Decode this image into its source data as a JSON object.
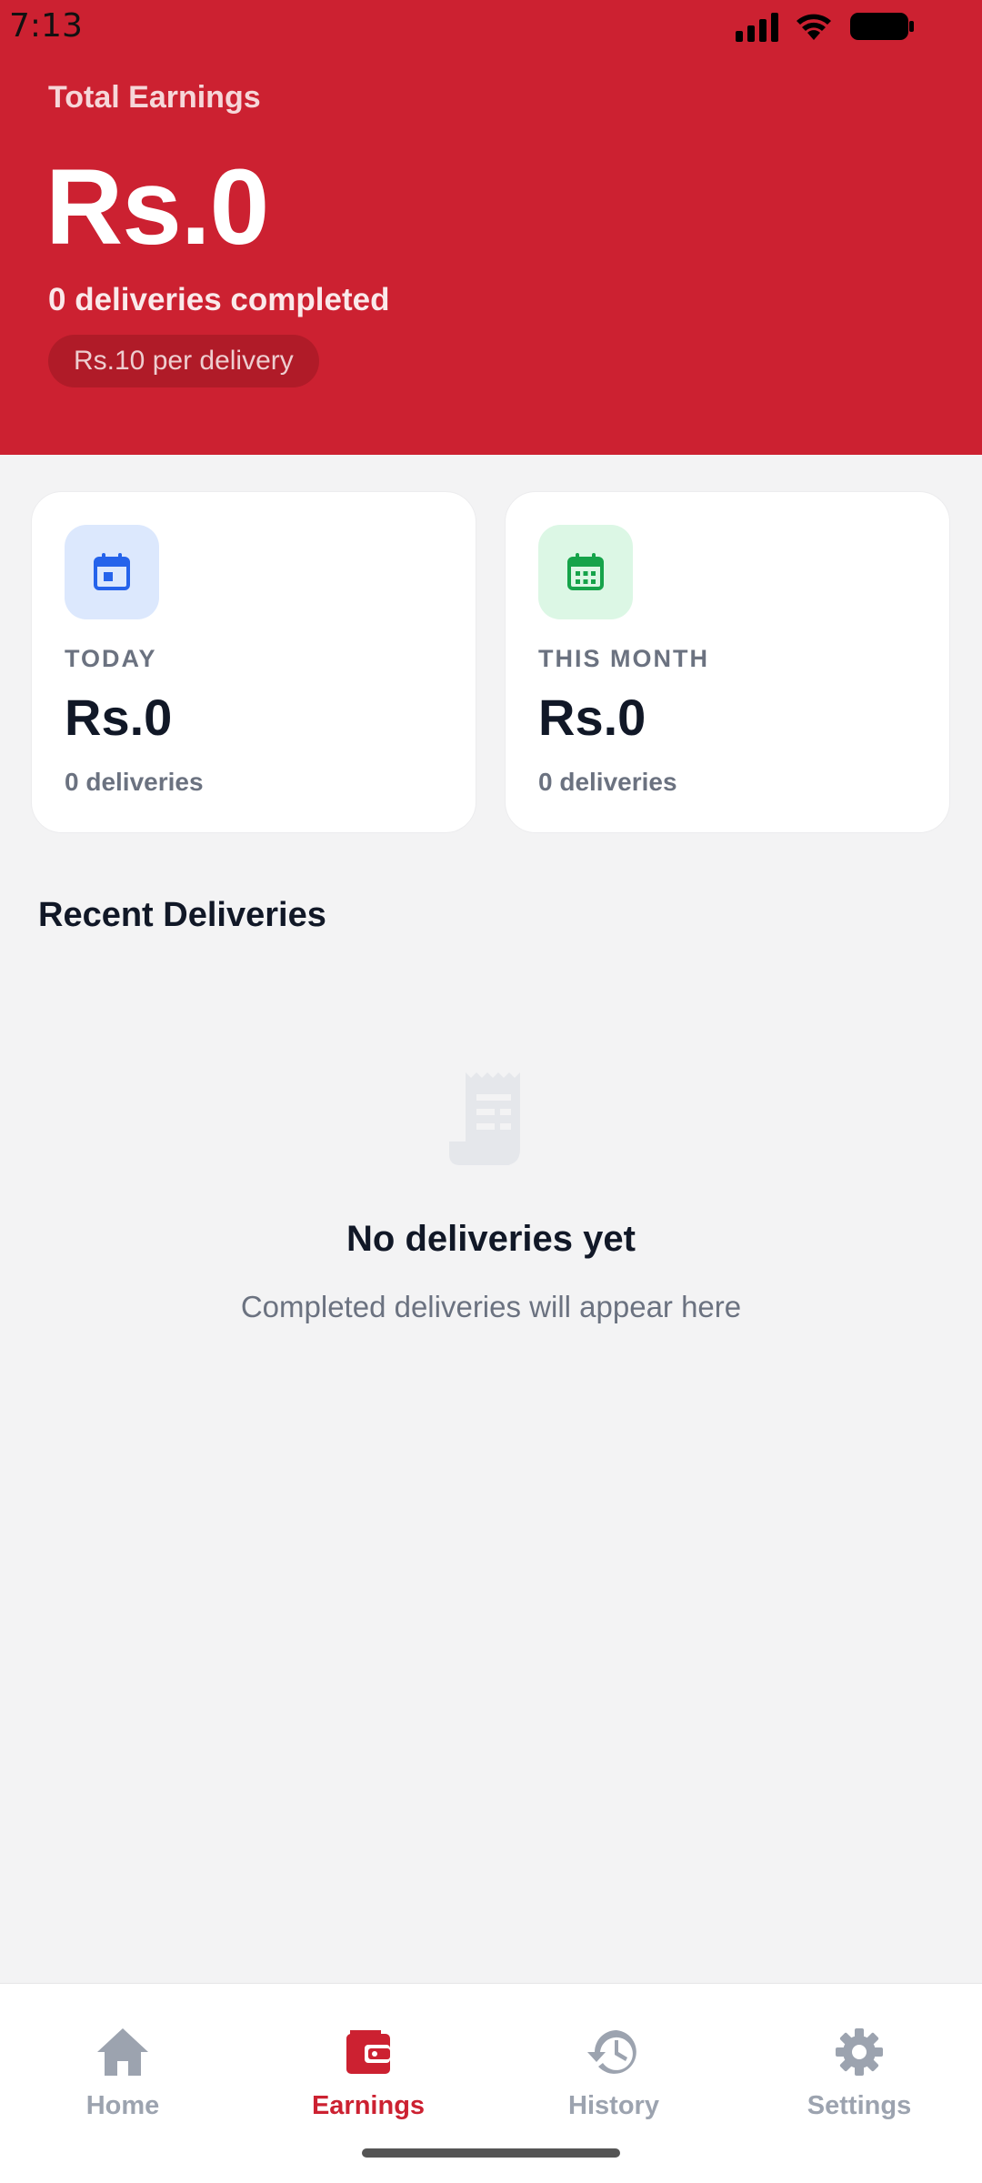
{
  "status_bar": {
    "time": "7:13"
  },
  "header": {
    "total_label": "Total Earnings",
    "total_value": "Rs.0",
    "deliveries_completed": "0 deliveries completed",
    "rate": "Rs.10 per delivery"
  },
  "cards": {
    "today": {
      "label": "TODAY",
      "value": "Rs.0",
      "sub": "0 deliveries",
      "icon": "calendar-today-icon"
    },
    "month": {
      "label": "THIS MONTH",
      "value": "Rs.0",
      "sub": "0 deliveries",
      "icon": "calendar-month-icon"
    }
  },
  "recent": {
    "title": "Recent Deliveries",
    "empty_title": "No deliveries yet",
    "empty_subtitle": "Completed deliveries will appear here",
    "empty_icon": "receipt-icon"
  },
  "nav": {
    "items": [
      {
        "label": "Home",
        "icon": "home-icon"
      },
      {
        "label": "Earnings",
        "icon": "wallet-icon",
        "active": true
      },
      {
        "label": "History",
        "icon": "history-icon"
      },
      {
        "label": "Settings",
        "icon": "gear-icon"
      }
    ]
  },
  "colors": {
    "brand": "#cc2131",
    "today_accent": "#2563eb",
    "month_accent": "#16a34a"
  }
}
